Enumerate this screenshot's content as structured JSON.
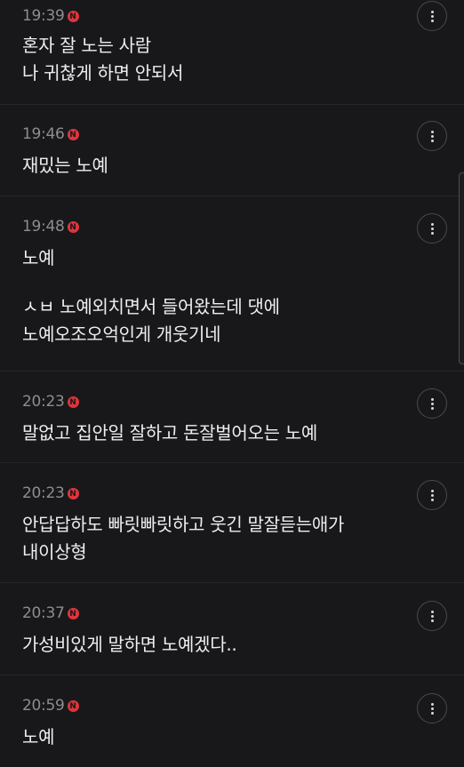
{
  "comments": [
    {
      "time": "19:39",
      "badge": "N",
      "lines": [
        "혼자 잘 노는 사람",
        "나 귀찮게 하면 안되서"
      ]
    },
    {
      "time": "19:46",
      "badge": "N",
      "lines": [
        "재밌는 노예"
      ]
    },
    {
      "time": "19:48",
      "badge": "N",
      "lines": [
        "노예"
      ],
      "extra_lines": [
        "ㅅㅂ 노예외치면서 들어왔는데 댓에",
        "노예오조오억인게 개웃기네"
      ]
    },
    {
      "time": "20:23",
      "badge": "N",
      "lines": [
        "말없고 집안일 잘하고 돈잘벌어오는 노예"
      ]
    },
    {
      "time": "20:23",
      "badge": "N",
      "lines": [
        "안답답하도 빠릿빠릿하고 웃긴 말잘듣는애가",
        "내이상형"
      ]
    },
    {
      "time": "20:37",
      "badge": "N",
      "lines": [
        "가성비있게 말하면 노예겠다.."
      ]
    },
    {
      "time": "20:59",
      "badge": "N",
      "lines": [
        "노예"
      ]
    }
  ],
  "colors": {
    "background": "#18181a",
    "badge": "#e0343b",
    "text": "#eeeeef",
    "time": "#8d8d8f"
  },
  "icons": {
    "more": "more-vertical-icon",
    "badge": "new-badge-icon"
  }
}
